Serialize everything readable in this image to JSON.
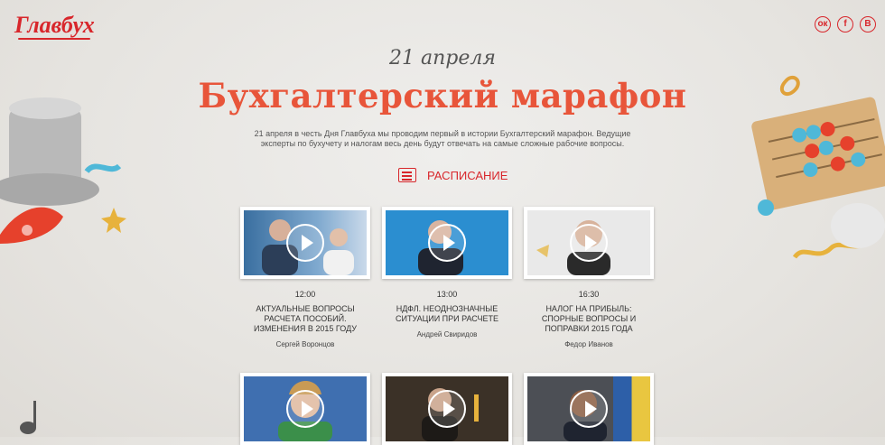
{
  "brand": {
    "logo_text": "Главбух"
  },
  "social": {
    "items": [
      "ок",
      "f",
      "В"
    ]
  },
  "hero": {
    "date": "21 апреля",
    "title": "Бухгалтерский марафон",
    "description": "21 апреля в честь Дня Главбуха мы проводим первый в истории Бухгалтерский марафон. Ведущие эксперты по бухучету и налогам весь день будут отвечать на самые сложные рабочие вопросы."
  },
  "schedule": {
    "label": "РАСПИСАНИЕ"
  },
  "sessions": [
    {
      "time": "12:00",
      "title": "АКТУАЛЬНЫЕ ВОПРОСЫ РАСЧЕТА ПОСОБИЙ. ИЗМЕНЕНИЯ В 2015 ГОДУ",
      "speaker": "Сергей Воронцов"
    },
    {
      "time": "13:00",
      "title": "НДФЛ. НЕОДНОЗНАЧНЫЕ СИТУАЦИИ ПРИ РАСЧЕТЕ",
      "speaker": "Андрей Свиридов"
    },
    {
      "time": "16:30",
      "title": "НАЛОГ НА ПРИБЫЛЬ: СПОРНЫЕ ВОПРОСЫ И ПОПРАВКИ 2015 ГОДА",
      "speaker": "Федор Иванов"
    },
    {
      "time": "",
      "title": "",
      "speaker": ""
    },
    {
      "time": "",
      "title": "",
      "speaker": ""
    },
    {
      "time": "",
      "title": "",
      "speaker": ""
    }
  ],
  "colors": {
    "brand_red": "#d8262b",
    "title_orange": "#e8553a"
  }
}
